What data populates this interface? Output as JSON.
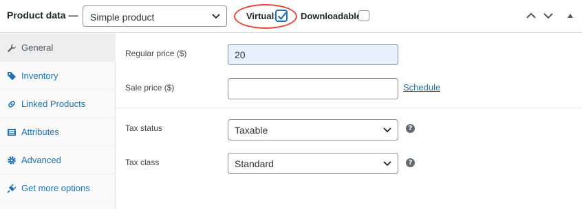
{
  "header": {
    "title": "Product data —",
    "product_type": "Simple product",
    "virtual_label": "Virtual:",
    "virtual_checked": true,
    "downloadable_label": "Downloadable:",
    "downloadable_checked": false
  },
  "sidebar": {
    "items": [
      {
        "label": "General",
        "icon": "wrench-icon",
        "active": true
      },
      {
        "label": "Inventory",
        "icon": "tag-icon",
        "active": false
      },
      {
        "label": "Linked Products",
        "icon": "link-icon",
        "active": false
      },
      {
        "label": "Attributes",
        "icon": "list-icon",
        "active": false
      },
      {
        "label": "Advanced",
        "icon": "gear-icon",
        "active": false
      },
      {
        "label": "Get more options",
        "icon": "plugin-icon",
        "active": false
      }
    ]
  },
  "fields": {
    "regular_price_label": "Regular price ($)",
    "regular_price_value": "20",
    "sale_price_label": "Sale price ($)",
    "sale_price_value": "",
    "schedule_link": "Schedule",
    "tax_status_label": "Tax status",
    "tax_status_value": "Taxable",
    "tax_class_label": "Tax class",
    "tax_class_value": "Standard",
    "help_glyph": "?"
  },
  "colors": {
    "link": "#2271b1",
    "highlight": "#e0443a",
    "autofill": "#e8f0fe"
  }
}
